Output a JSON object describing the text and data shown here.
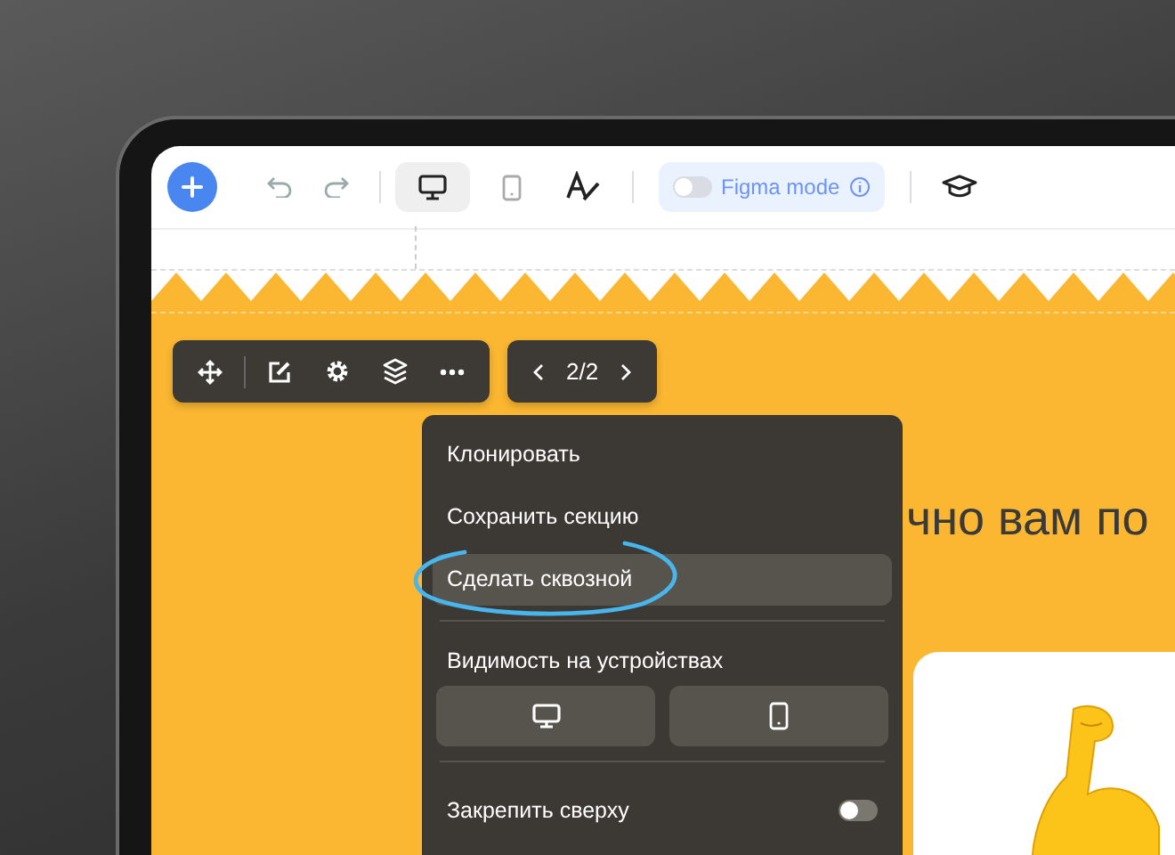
{
  "toolbar": {
    "views": [
      {
        "kind": "desktop",
        "selected": true
      },
      {
        "kind": "mobile",
        "selected": false
      }
    ],
    "figma_mode": {
      "label": "Figma mode",
      "on": false
    }
  },
  "section_toolbar": {
    "pager": "2/2"
  },
  "heading": "чно вам по",
  "context_menu": {
    "items": [
      {
        "kind": "action",
        "label": "Клонировать",
        "selected": false,
        "annotated": false
      },
      {
        "kind": "action",
        "label": "Сохранить секцию",
        "selected": false,
        "annotated": false
      },
      {
        "kind": "action",
        "label": "Сделать сквозной",
        "selected": true,
        "annotated": true
      },
      {
        "kind": "devices",
        "label": "Видимость на устройствах",
        "devices": [
          {
            "kind": "desktop"
          },
          {
            "kind": "mobile"
          }
        ]
      },
      {
        "kind": "toggle",
        "label": "Закрепить сверху",
        "on": false
      }
    ]
  }
}
